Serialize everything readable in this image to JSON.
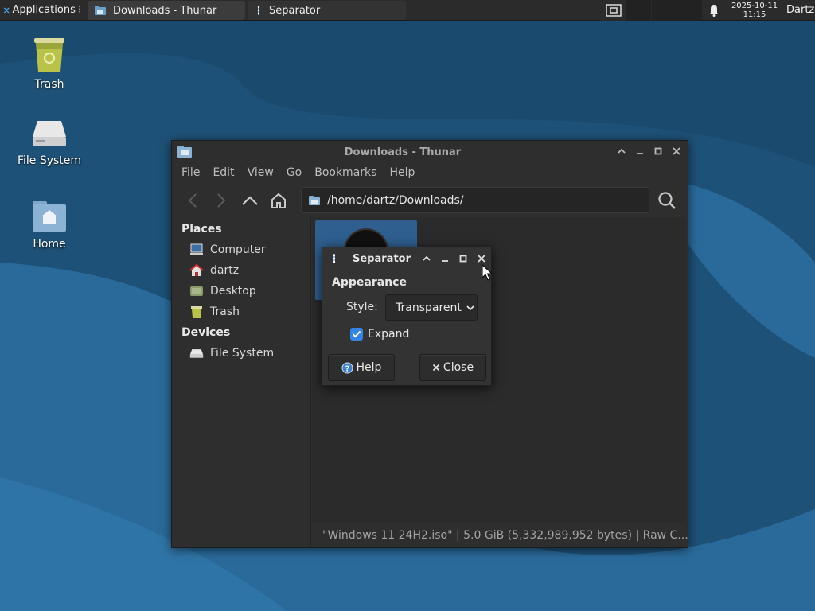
{
  "panel": {
    "apps_label": "Applications",
    "tasks": [
      {
        "label": "Downloads - Thunar"
      },
      {
        "label": "Separator"
      }
    ],
    "clock_date": "2025-10-11",
    "clock_time": "11:15",
    "user": "Dartz"
  },
  "desktop_icons": [
    {
      "label": "Trash"
    },
    {
      "label": "File System"
    },
    {
      "label": "Home"
    }
  ],
  "thunar": {
    "title": "Downloads - Thunar",
    "menus": [
      "File",
      "Edit",
      "View",
      "Go",
      "Bookmarks",
      "Help"
    ],
    "location": "/home/dartz/Downloads/",
    "sidebar": {
      "places_heading": "Places",
      "places": [
        {
          "label": "Computer",
          "icon": "computer-icon"
        },
        {
          "label": "dartz",
          "icon": "home-folder-icon"
        },
        {
          "label": "Desktop",
          "icon": "desktop-icon"
        },
        {
          "label": "Trash",
          "icon": "trash-icon"
        }
      ],
      "devices_heading": "Devices",
      "devices": [
        {
          "label": "File System",
          "icon": "drive-icon"
        }
      ]
    },
    "status": "\"Windows 11 24H2.iso\"  |  5.0 GiB (5,332,989,952 bytes)  |  Raw C..."
  },
  "separator_dialog": {
    "title": "Separator",
    "section": "Appearance",
    "style_label": "Style:",
    "style_value": "Transparent",
    "expand_label": "Expand",
    "expand_checked": true,
    "help_label": "Help",
    "close_label": "Close"
  },
  "colors": {
    "accent": "#3584e4",
    "desktop_dark": "#1d4f74",
    "desktop_light": "#2a6a98"
  }
}
